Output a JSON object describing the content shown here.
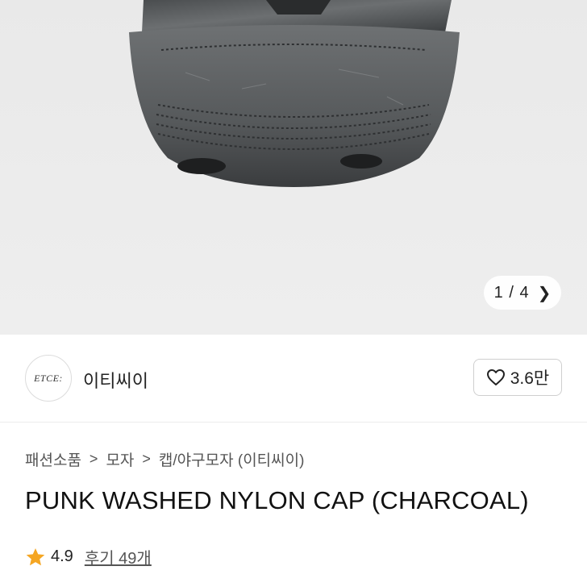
{
  "gallery": {
    "current": "1",
    "separator": "/",
    "total": "4",
    "next_icon": "chevron-right-icon"
  },
  "brand": {
    "logo_text": "ETCE:",
    "name": "이티씨이"
  },
  "like": {
    "icon": "heart-outline-icon",
    "count": "3.6만"
  },
  "breadcrumb": {
    "items": [
      "패션소품",
      "모자",
      "캡/야구모자 (이티씨이)"
    ],
    "separator": ">"
  },
  "product": {
    "title": "PUNK WASHED NYLON CAP (CHARCOAL)"
  },
  "rating": {
    "icon": "star-icon",
    "value": "4.9",
    "star_color": "#f5a623",
    "reviews_link": "후기 49개"
  }
}
